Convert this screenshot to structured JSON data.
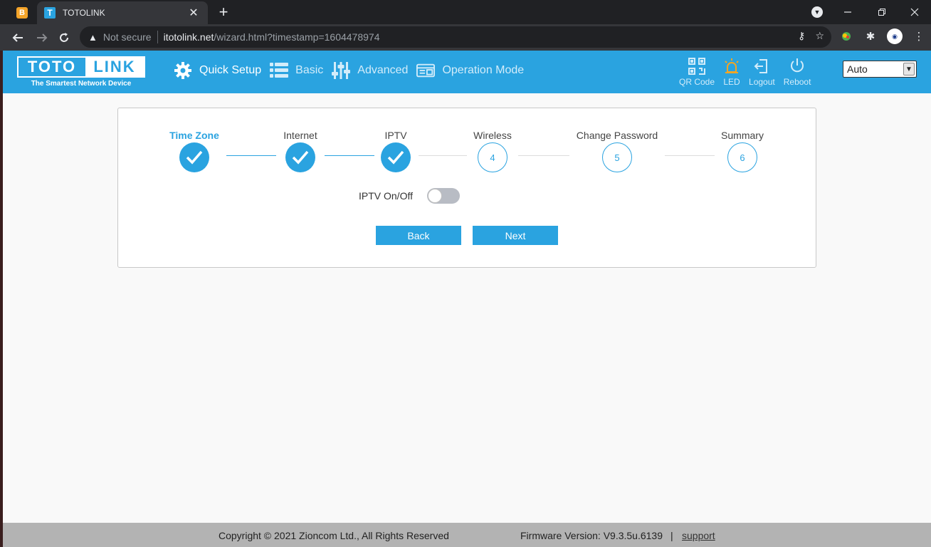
{
  "browser": {
    "inactive_tab_favicon": "B",
    "active_tab_favicon": "T",
    "active_tab_title": "TOTOLINK",
    "tab_close": "✕",
    "new_tab": "+",
    "security_label": "Not secure",
    "url_host": "itotolink.net",
    "url_path": "/wizard.html?timestamp=1604478974"
  },
  "header": {
    "logo_left": "TOTO",
    "logo_right": "LINK",
    "tagline": "The Smartest Network Device",
    "menu": [
      {
        "label": "Quick Setup",
        "icon": "gear-icon"
      },
      {
        "label": "Basic",
        "icon": "list-icon"
      },
      {
        "label": "Advanced",
        "icon": "sliders-icon"
      },
      {
        "label": "Operation Mode",
        "icon": "mode-icon"
      }
    ],
    "tools": [
      {
        "label": "QR Code",
        "icon": "qr-code-icon"
      },
      {
        "label": "LED",
        "icon": "led-icon"
      },
      {
        "label": "Logout",
        "icon": "logout-icon"
      },
      {
        "label": "Reboot",
        "icon": "power-icon"
      }
    ],
    "language": "Auto"
  },
  "wizard": {
    "steps": [
      {
        "label": "Time Zone",
        "status": "done"
      },
      {
        "label": "Internet",
        "status": "done"
      },
      {
        "label": "IPTV",
        "status": "done"
      },
      {
        "label": "Wireless",
        "number": "4",
        "status": "todo"
      },
      {
        "label": "Change Password",
        "number": "5",
        "status": "todo"
      },
      {
        "label": "Summary",
        "number": "6",
        "status": "todo"
      }
    ],
    "toggle_label": "IPTV On/Off",
    "toggle_on": false,
    "back_label": "Back",
    "next_label": "Next"
  },
  "footer": {
    "copyright": "Copyright © 2021 Zioncom Ltd., All Rights Reserved",
    "firmware": "Firmware Version: V9.3.5u.6139",
    "separator": "|",
    "support": "support"
  },
  "colors": {
    "brand_blue": "#2aa3e0",
    "footer_gray": "#b3b3b3",
    "led_orange": "#f5a623"
  }
}
